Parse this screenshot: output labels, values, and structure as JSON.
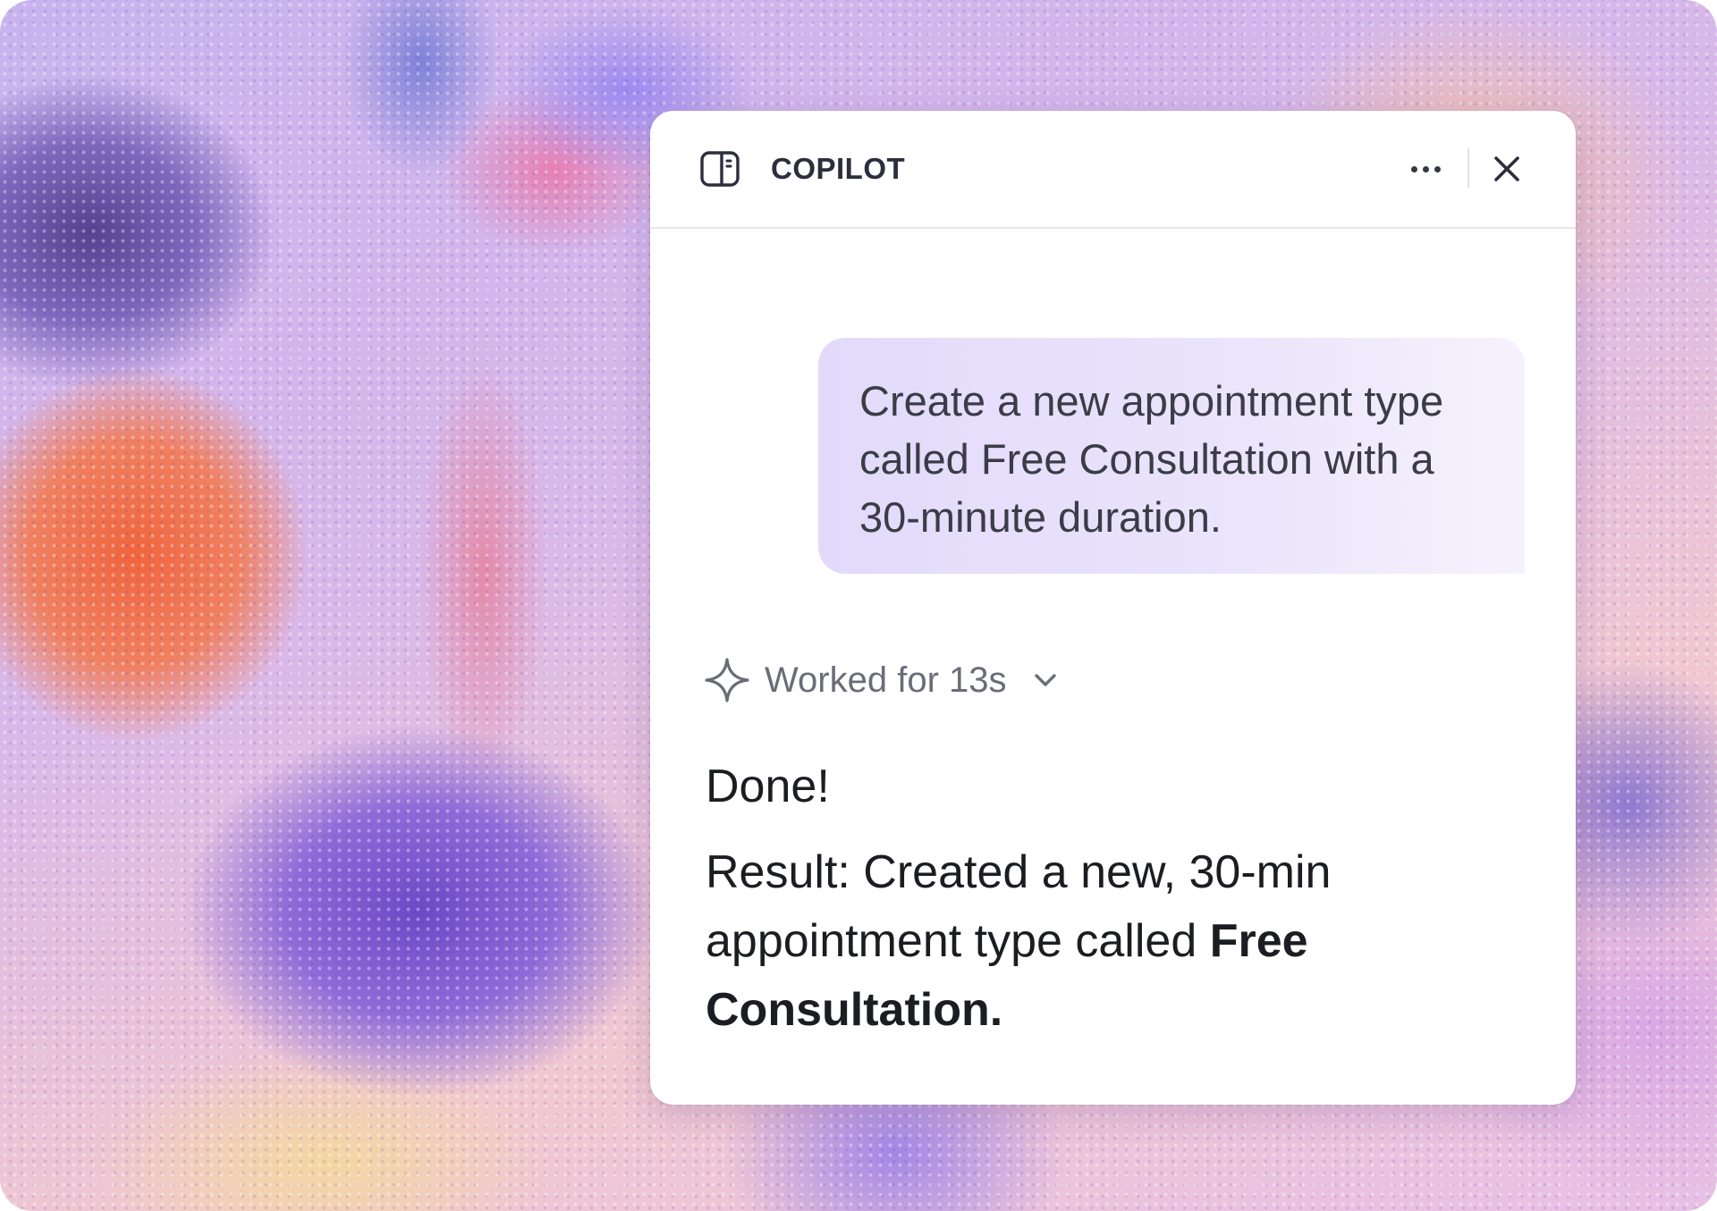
{
  "panel": {
    "title": "COPILOT",
    "icons": {
      "panel": "sidebar-panel-icon",
      "more": "more-horizontal-icon",
      "close": "close-icon"
    }
  },
  "conversation": {
    "user_message": "Create a new appointment type called Free Consultation with a 30-minute duration.",
    "status": {
      "label": "Worked for 13s",
      "icon": "sparkle-icon",
      "toggle_icon": "chevron-down-icon"
    },
    "reply": {
      "headline": "Done!",
      "result_prefix": "Result: Created a new, 30-min appointment type called ",
      "result_bold": "Free Consultation."
    }
  },
  "colors": {
    "bubble": "#e3dafb",
    "title_text": "#2b2f3b",
    "muted_text": "#6a6d77"
  }
}
